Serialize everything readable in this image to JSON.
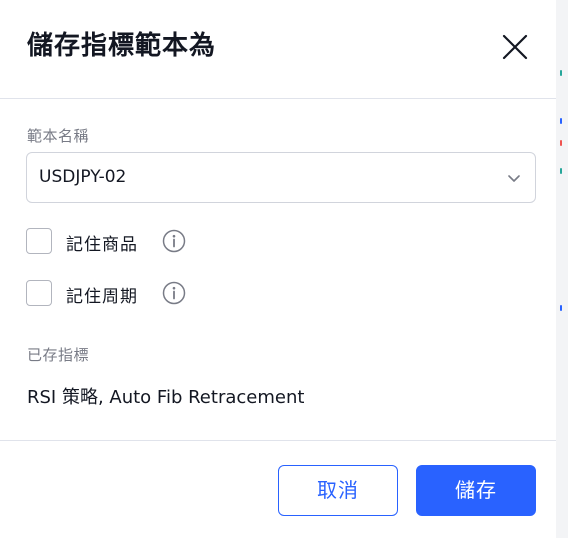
{
  "dialog": {
    "title": "儲存指標範本為"
  },
  "template_name": {
    "label": "範本名稱",
    "value": "USDJPY-02"
  },
  "options": {
    "remember_symbol": {
      "label": "記住商品",
      "checked": false
    },
    "remember_interval": {
      "label": "記住周期",
      "checked": false
    }
  },
  "saved_indicators": {
    "label": "已存指標",
    "value": "RSI 策略, Auto Fib Retracement"
  },
  "buttons": {
    "cancel": "取消",
    "save": "儲存"
  },
  "colors": {
    "accent": "#2962ff",
    "border": "#d1d4dc",
    "muted_text": "#787b86",
    "text": "#131722"
  },
  "icons": {
    "close": "close-icon",
    "dropdown": "chevron-down-icon",
    "info": "info-icon"
  }
}
